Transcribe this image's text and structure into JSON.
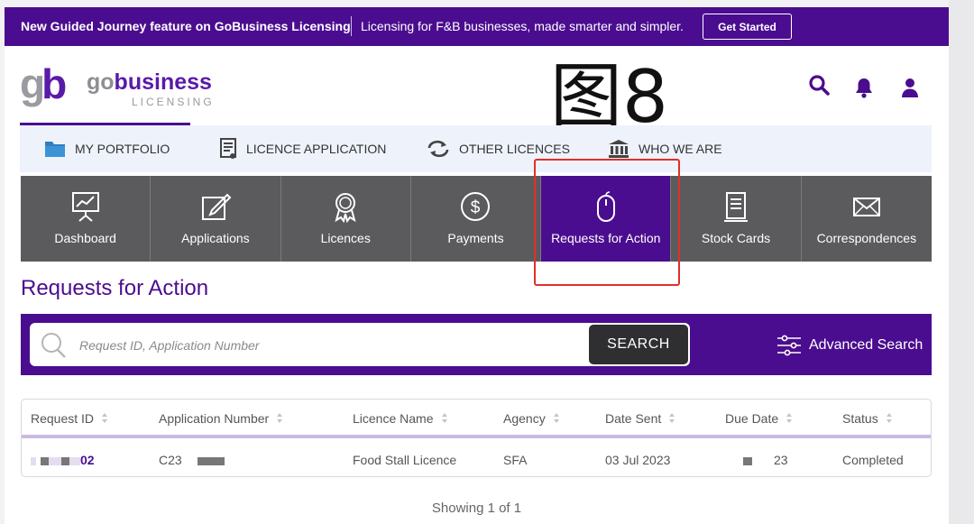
{
  "banner": {
    "title": "New Guided Journey feature on GoBusiness Licensing",
    "subtitle": "Licensing for F&B businesses, made smarter and simpler.",
    "cta": "Get Started"
  },
  "logo": {
    "mark_left": "g",
    "mark_right": "b",
    "word_go": "go",
    "word_business": "business",
    "word_licensing": "LICENSING"
  },
  "watermark": "图8",
  "subnav": {
    "items": [
      {
        "label": "MY PORTFOLIO",
        "icon": "folder-icon"
      },
      {
        "label": "LICENCE APPLICATION",
        "icon": "form-icon"
      },
      {
        "label": "OTHER LICENCES",
        "icon": "exchange-icon"
      },
      {
        "label": "WHO WE ARE",
        "icon": "bank-icon"
      }
    ]
  },
  "tiles": [
    {
      "label": "Dashboard",
      "icon": "presentation-chart-icon",
      "active": false
    },
    {
      "label": "Applications",
      "icon": "edit-icon",
      "active": false
    },
    {
      "label": "Licences",
      "icon": "award-icon",
      "active": false
    },
    {
      "label": "Payments",
      "icon": "dollar-icon",
      "active": false
    },
    {
      "label": "Requests for Action",
      "icon": "mouse-icon",
      "active": true
    },
    {
      "label": "Stock Cards",
      "icon": "document-icon",
      "active": false
    },
    {
      "label": "Correspondences",
      "icon": "envelope-icon",
      "active": false
    }
  ],
  "page_title": "Requests for Action",
  "search": {
    "placeholder": "Request ID, Application Number",
    "button": "SEARCH",
    "advanced": "Advanced Search"
  },
  "table": {
    "headers": [
      "Request ID",
      "Application Number",
      "Licence Name",
      "Agency",
      "Date Sent",
      "Due Date",
      "Status"
    ],
    "rows": [
      {
        "request_id_suffix": "02",
        "application_number_prefix": "C23",
        "licence_name": "Food Stall Licence",
        "agency": "SFA",
        "date_sent": "03 Jul 2023",
        "due_date_suffix": "23",
        "status": "Completed"
      }
    ]
  },
  "pagination": {
    "showing": "Showing 1 of 1"
  },
  "colors": {
    "brand_purple": "#4b0d8f",
    "tile_grey": "#5b5b5d",
    "highlight_red": "#e0302a"
  }
}
